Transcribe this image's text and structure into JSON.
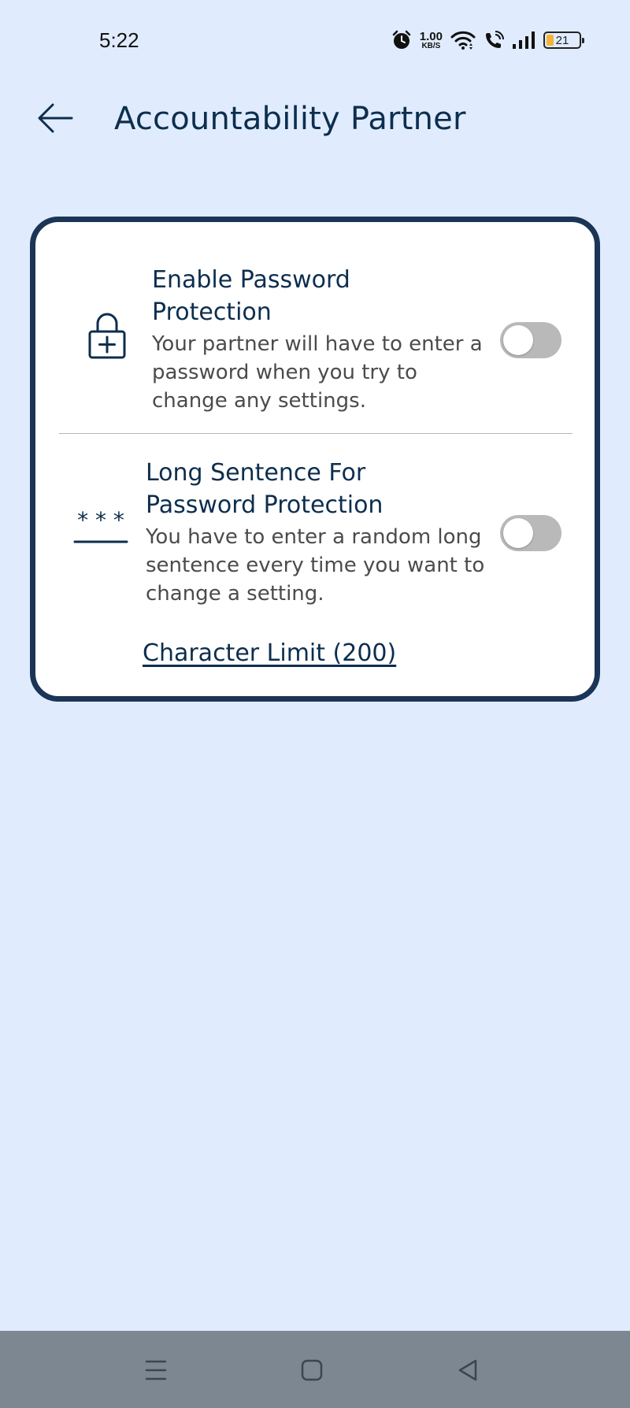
{
  "status_bar": {
    "time": "5:22",
    "net_speed_value": "1.00",
    "net_speed_unit": "KB/S",
    "battery_level": "21",
    "icons": [
      "alarm-icon",
      "wifi-icon",
      "wifi-calling-icon",
      "signal-icon",
      "battery-icon"
    ]
  },
  "header": {
    "title": "Accountability Partner",
    "back_icon": "arrow-left-icon"
  },
  "settings": [
    {
      "icon": "lock-plus-icon",
      "title": "Enable Password Protection",
      "description": "Your partner will have to enter a password when you try to change any settings.",
      "enabled": false
    },
    {
      "icon": "password-dots-icon",
      "icon_text": "* * *",
      "title": "Long Sentence For Password Protection",
      "description": "You have to enter a random long sentence every time you want to change a setting.",
      "enabled": false
    }
  ],
  "character_limit_label": "Character Limit (200)",
  "nav_bar": {
    "icons": [
      "menu-icon",
      "home-icon",
      "back-triangle-icon"
    ]
  },
  "colors": {
    "background": "#e0ecfd",
    "card_border": "#1b3556",
    "primary_text": "#0d2e4e",
    "toggle_off": "#b9b9b9",
    "nav_bar": "#7d8791"
  }
}
